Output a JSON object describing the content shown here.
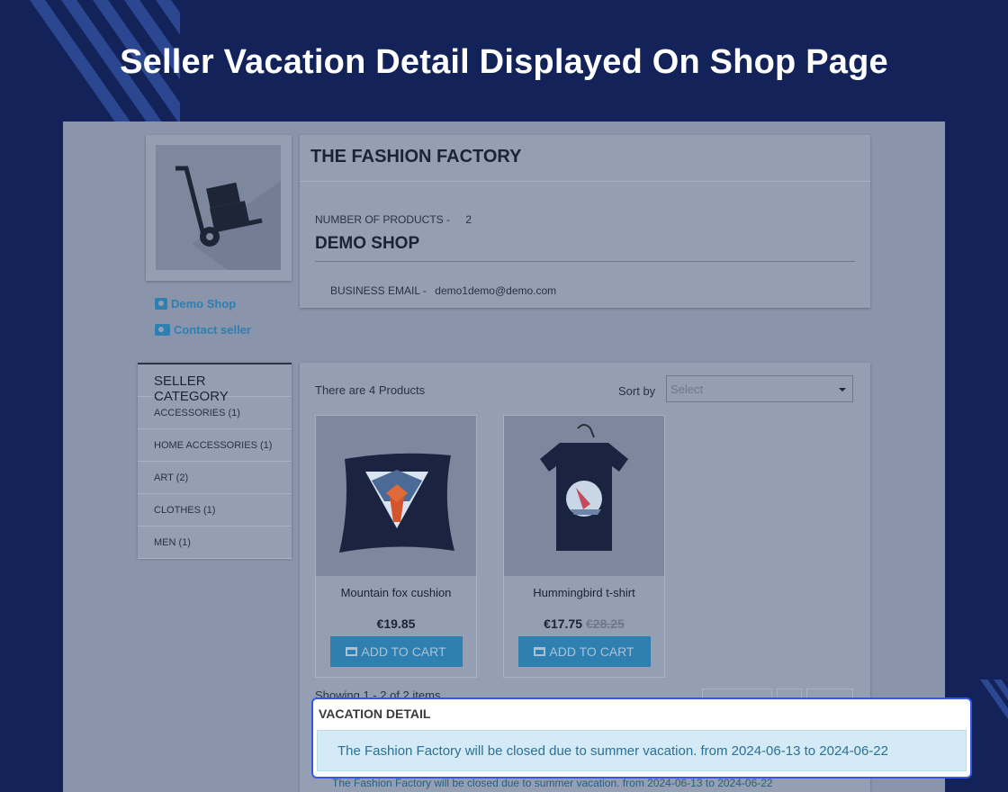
{
  "banner": {
    "title": "Seller Vacation Detail Displayed On Shop Page"
  },
  "shop": {
    "name": "THE FASHION FACTORY",
    "number_of_products_label": "NUMBER OF PRODUCTS -",
    "number_of_products_value": "2",
    "shop_title": "DEMO SHOP",
    "business_email_label": "BUSINESS EMAIL -",
    "business_email_value": "demo1demo@demo.com"
  },
  "links": {
    "demo_shop": "Demo Shop",
    "contact_seller": "Contact seller"
  },
  "categories": {
    "heading": "SELLER CATEGORY",
    "items": [
      {
        "label": "ACCESSORIES (1)"
      },
      {
        "label": "HOME ACCESSORIES (1)"
      },
      {
        "label": "ART (2)"
      },
      {
        "label": "CLOTHES (1)"
      },
      {
        "label": "MEN (1)"
      }
    ]
  },
  "listing": {
    "count_text": "There are 4 Products",
    "sort_label": "Sort by",
    "sort_placeholder": "Select",
    "showing_text": "Showing 1 - 2 of 2 items"
  },
  "products": [
    {
      "name": "Mountain fox cushion",
      "price": "€19.85",
      "old_price": "",
      "button": "ADD TO CART",
      "icon": "cushion-image"
    },
    {
      "name": "Hummingbird t-shirt",
      "price": "€17.75",
      "old_price": "€28.25",
      "button": "ADD TO CART",
      "icon": "tshirt-image"
    }
  ],
  "vacation": {
    "title": "VACATION DETAIL",
    "message": "The Fashion Factory will be closed due to summer vacation. from 2024-06-13 to 2024-06-22"
  },
  "colors": {
    "banner_bg": "#13235a",
    "accent": "#2f7fb0",
    "popup_border": "#3558e8",
    "alert_bg": "#d4eaf6"
  }
}
